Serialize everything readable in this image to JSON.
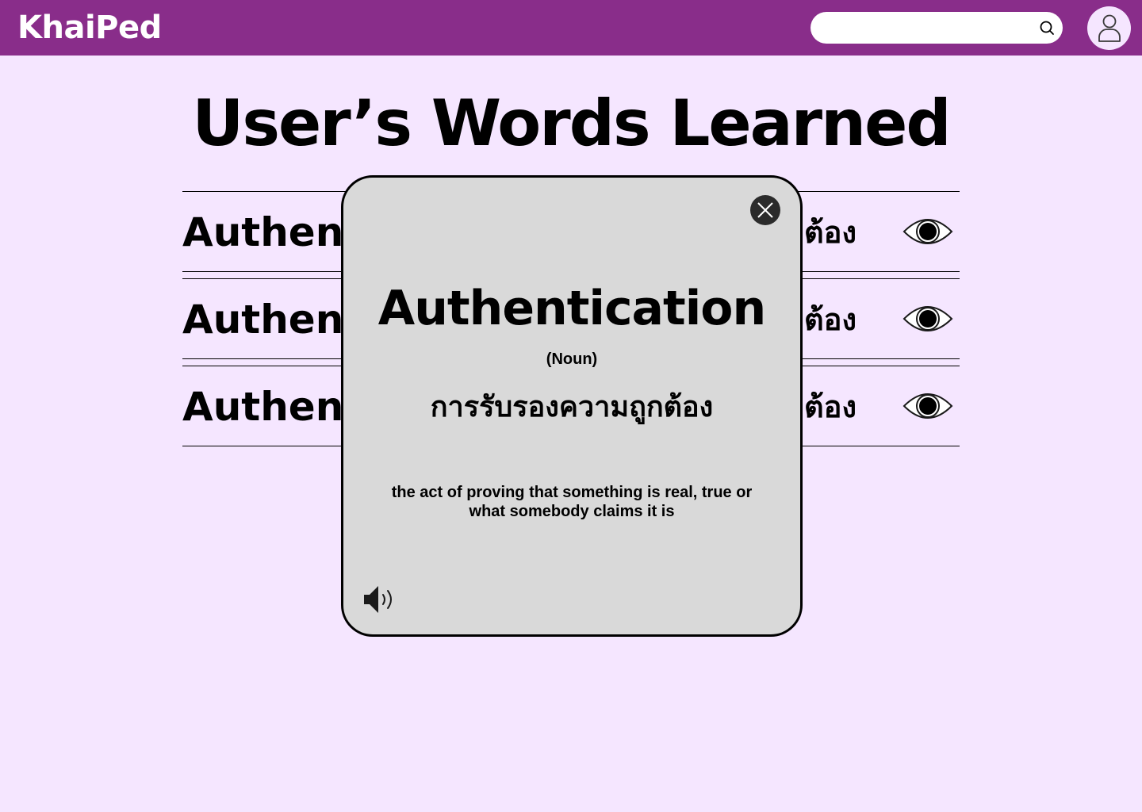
{
  "header": {
    "logo": "KhaiPed",
    "search": {
      "placeholder": "",
      "value": "",
      "icon": "search-icon"
    },
    "avatar_icon": "user-icon",
    "background": "#892d8a"
  },
  "page": {
    "title": "User’s Words Learned",
    "background": "#f5e6ff"
  },
  "words": [
    {
      "word": "Authentication",
      "translation": "การรับรองความถูกต้อง",
      "icon": "eye-icon"
    },
    {
      "word": "Authentication",
      "translation": "การรับรองความถูกต้อง",
      "icon": "eye-icon"
    },
    {
      "word": "Authentication",
      "translation": "การรับรองความถูกต้อง",
      "icon": "eye-icon"
    }
  ],
  "modal": {
    "word": "Authentication",
    "part_of_speech": "(Noun)",
    "translation": "การรับรองความถูกต้อง",
    "definition": "the act of proving that something is real, true or what somebody claims it is",
    "close_icon": "close-icon",
    "audio_icon": "speaker-icon",
    "background": "#d9d9d9"
  }
}
